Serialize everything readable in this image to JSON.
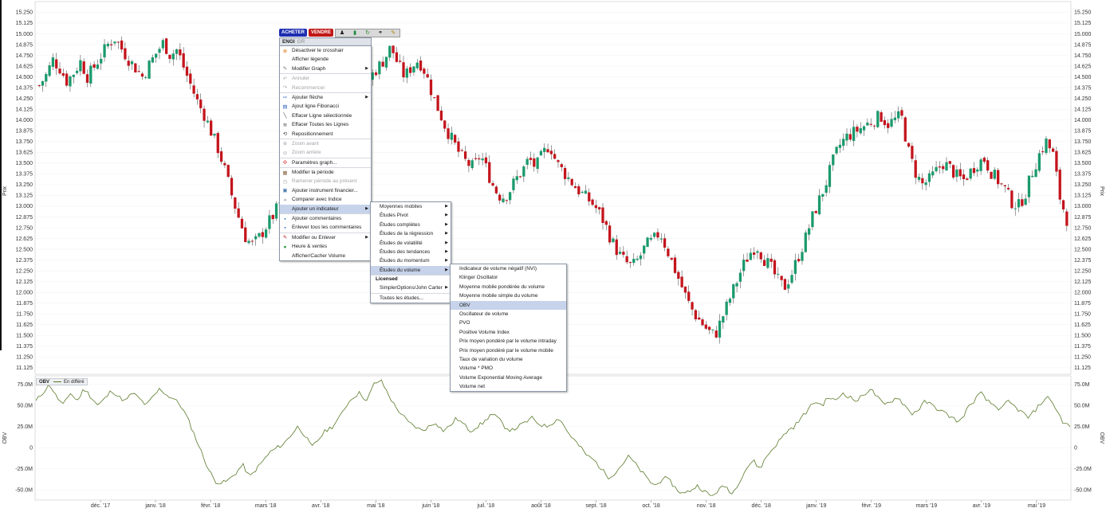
{
  "toolbar": {
    "buy_label": "ACHETER",
    "sell_label": "VENDRE",
    "icons": [
      "person-icon",
      "bar-chart-icon",
      "refresh-icon",
      "link-icon",
      "pencil-icon"
    ]
  },
  "context_menu": {
    "symbol": "ENGI",
    "symbol_suffix": "GR",
    "items": [
      {
        "label": "Désactiver le crosshair",
        "icon": "crosshair-icon",
        "enabled": true
      },
      {
        "label": "Afficher légende",
        "icon": "",
        "enabled": true
      },
      {
        "label": "Modifier Graph",
        "icon": "wrench-icon",
        "enabled": true,
        "submenu": true
      },
      {
        "label": "Annuler",
        "icon": "undo-icon",
        "enabled": false
      },
      {
        "label": "Recommencer",
        "icon": "redo-icon",
        "enabled": false
      },
      {
        "label": "Ajouter flèche",
        "icon": "arrow-icon",
        "enabled": true,
        "submenu": true
      },
      {
        "label": "Ajout ligne Fibonacci",
        "icon": "fibonacci-icon",
        "enabled": true
      },
      {
        "label": "Effacer Ligne sélectionnée",
        "icon": "line-icon",
        "enabled": true
      },
      {
        "label": "Effacer Toutes les Lignes",
        "icon": "lines-icon",
        "enabled": true
      },
      {
        "label": "Repositionnement",
        "icon": "reposition-icon",
        "enabled": true
      },
      {
        "label": "Zoom avant",
        "icon": "zoom-in-icon",
        "enabled": false
      },
      {
        "label": "Zoom arrière",
        "icon": "zoom-out-icon",
        "enabled": false
      },
      {
        "label": "Paramètres graph...",
        "icon": "settings-icon",
        "enabled": true
      },
      {
        "label": "Modifier la période",
        "icon": "calendar-icon",
        "enabled": true
      },
      {
        "label": "Ramener période au présent",
        "icon": "clock-icon",
        "enabled": false
      },
      {
        "label": "Ajouter instrument financier...",
        "icon": "instrument-icon",
        "enabled": true
      },
      {
        "label": "Comparer avec Indice",
        "icon": "compare-icon",
        "enabled": true
      },
      {
        "label": "Ajouter un indicateur",
        "icon": "",
        "enabled": true,
        "submenu": true,
        "highlighted": true
      },
      {
        "label": "Ajouter commentaires",
        "icon": "comment-icon",
        "enabled": true
      },
      {
        "label": "Enlever tous les commentaires",
        "icon": "remove-comment-icon",
        "enabled": true
      },
      {
        "label": "Modifier ou Enlever",
        "icon": "edit-icon",
        "enabled": true,
        "submenu": true
      },
      {
        "label": "Heure & ventes",
        "icon": "time-sales-icon",
        "enabled": true
      },
      {
        "label": "Afficher/Cacher Volume",
        "icon": "",
        "enabled": true
      }
    ]
  },
  "indicator_menu": {
    "items": [
      {
        "label": "Moyennes mobiles",
        "submenu": true
      },
      {
        "label": "Études Pivot",
        "submenu": true
      },
      {
        "label": "Études complètes",
        "submenu": true
      },
      {
        "label": "Études de la régression",
        "submenu": true
      },
      {
        "label": "Études de volatilité",
        "submenu": true
      },
      {
        "label": "Études des tendances",
        "submenu": true
      },
      {
        "label": "Études du momentum",
        "submenu": true
      },
      {
        "label": "Études du volume",
        "submenu": true,
        "highlighted": true
      }
    ],
    "licensed_header": "Licensed",
    "licensed_items": [
      {
        "label": "SimplerOptions/John Carter",
        "submenu": true
      }
    ],
    "footer": "Toutes les études..."
  },
  "volume_menu": {
    "items": [
      {
        "label": "Indicateur de volume négatif (NVI)"
      },
      {
        "label": "Klinger Oscillator"
      },
      {
        "label": "Moyenne mobile pondérée du volume"
      },
      {
        "label": "Moyenne mobile simple du volume"
      },
      {
        "label": "OBV",
        "highlighted": true
      },
      {
        "label": "Oscillateur de volume"
      },
      {
        "label": "PVO"
      },
      {
        "label": "Positive Volume Index"
      },
      {
        "label": "Prix moyen pondéré par le volume intraday"
      },
      {
        "label": "Prix moyen pondéré par le volume mobile"
      },
      {
        "label": "Taux de variation du volume"
      },
      {
        "label": "Volume * PMO"
      },
      {
        "label": "Volume Exponential Moving Average"
      },
      {
        "label": "Volume net"
      }
    ]
  },
  "indicator_legend": {
    "name": "OBV",
    "series": "En différé"
  },
  "colors": {
    "up": "#1a9a6c",
    "down": "#c4141c",
    "obv_line": "#5a7a2a",
    "menu_highlight": "#c6d3ea"
  },
  "chart_data": [
    {
      "type": "candlestick",
      "ylabel_left": "Prix",
      "ylabel_right": "Prix",
      "yticks": [
        "15.250",
        "15.125",
        "15.000",
        "14.875",
        "14.750",
        "14.625",
        "14.500",
        "14.375",
        "14.250",
        "14.125",
        "14.000",
        "13.875",
        "13.750",
        "13.625",
        "13.500",
        "13.375",
        "13.250",
        "13.125",
        "13.000",
        "12.875",
        "12.750",
        "12.625",
        "12.500",
        "12.375",
        "12.250",
        "12.125",
        "12.000",
        "11.875",
        "11.750",
        "11.625",
        "11.500",
        "11.375",
        "11.250",
        "11.125"
      ],
      "ylim": [
        11.05,
        15.3
      ],
      "xticks": [
        "déc. '17",
        "janv. '18",
        "févr. '18",
        "mars '18",
        "avr. '18",
        "mai '18",
        "juin '18",
        "juil. '18",
        "août '18",
        "sept. '18",
        "oct. '18",
        "nov. '18",
        "déc. '18",
        "janv. '19",
        "févr. '19",
        "mars '19",
        "avr. '19",
        "mai '19"
      ],
      "close_path": [
        14.4,
        14.52,
        14.7,
        14.6,
        14.45,
        14.55,
        14.68,
        14.5,
        14.62,
        14.75,
        14.88,
        14.95,
        14.82,
        14.7,
        14.6,
        14.5,
        14.65,
        14.78,
        14.9,
        14.75,
        14.82,
        14.6,
        14.4,
        14.2,
        14.05,
        13.85,
        13.65,
        13.4,
        13.1,
        12.85,
        12.62,
        12.55,
        12.65,
        12.78,
        12.9,
        13.05,
        12.75,
        12.42,
        12.6,
        12.85,
        13.1,
        13.3,
        13.5,
        13.65,
        13.8,
        14.0,
        14.2,
        14.35,
        14.5,
        14.6,
        14.7,
        14.85,
        14.65,
        14.5,
        14.62,
        14.7,
        14.55,
        14.3,
        14.1,
        13.9,
        13.75,
        13.6,
        13.5,
        13.45,
        13.6,
        13.4,
        13.2,
        13.1,
        13.15,
        13.3,
        13.4,
        13.55,
        13.45,
        13.6,
        13.72,
        13.5,
        13.4,
        13.3,
        13.2,
        13.12,
        13.05,
        12.95,
        12.8,
        12.6,
        12.45,
        12.35,
        12.3,
        12.4,
        12.55,
        12.6,
        12.7,
        12.5,
        12.3,
        12.1,
        11.9,
        11.75,
        11.65,
        11.55,
        11.5,
        11.7,
        11.9,
        12.1,
        12.3,
        12.45,
        12.55,
        12.4,
        12.3,
        12.15,
        12.05,
        12.2,
        12.4,
        12.6,
        12.85,
        13.05,
        13.25,
        13.5,
        13.7,
        13.8,
        13.85,
        13.9,
        13.95,
        14.0,
        14.05,
        13.95,
        14.0,
        14.05,
        13.65,
        13.4,
        13.25,
        13.3,
        13.4,
        13.5,
        13.45,
        13.35,
        13.3,
        13.4,
        13.5,
        13.55,
        13.4,
        13.3,
        13.2,
        13.05,
        13.0,
        13.15,
        13.4,
        13.6,
        13.75,
        13.6,
        13.1,
        12.85
      ]
    },
    {
      "type": "line",
      "name": "OBV",
      "ylabel": "OBV",
      "yticks": [
        "75.0M",
        "50.0M",
        "25.0M",
        "0",
        "-25.0M",
        "-50.0M"
      ],
      "ylim": [
        -62,
        85
      ],
      "values": [
        55,
        65,
        75,
        60,
        50,
        65,
        55,
        70,
        60,
        50,
        58,
        68,
        60,
        55,
        65,
        58,
        50,
        60,
        70,
        62,
        58,
        50,
        35,
        15,
        -5,
        -25,
        -40,
        -42,
        -38,
        -30,
        -20,
        -35,
        -25,
        -15,
        -5,
        0,
        5,
        15,
        25,
        15,
        0,
        10,
        20,
        25,
        35,
        50,
        60,
        65,
        55,
        75,
        80,
        65,
        50,
        40,
        30,
        25,
        20,
        25,
        30,
        20,
        25,
        35,
        28,
        20,
        25,
        30,
        40,
        35,
        25,
        20,
        25,
        30,
        35,
        28,
        25,
        30,
        35,
        20,
        10,
        0,
        -10,
        -15,
        -25,
        -35,
        -30,
        -20,
        -10,
        -20,
        -30,
        -40,
        -45,
        -35,
        -40,
        -50,
        -55,
        -50,
        -45,
        -52,
        -58,
        -50,
        -45,
        -55,
        -40,
        -25,
        -15,
        -25,
        -10,
        0,
        10,
        20,
        25,
        35,
        45,
        55,
        50,
        60,
        55,
        65,
        60,
        55,
        62,
        70,
        60,
        50,
        55,
        60,
        50,
        40,
        45,
        55,
        50,
        45,
        40,
        35,
        30,
        45,
        55,
        65,
        55,
        50,
        45,
        55,
        48,
        42,
        35,
        45,
        55,
        60,
        45,
        30,
        25
      ],
      "x_extent_frac": 1.0
    }
  ]
}
